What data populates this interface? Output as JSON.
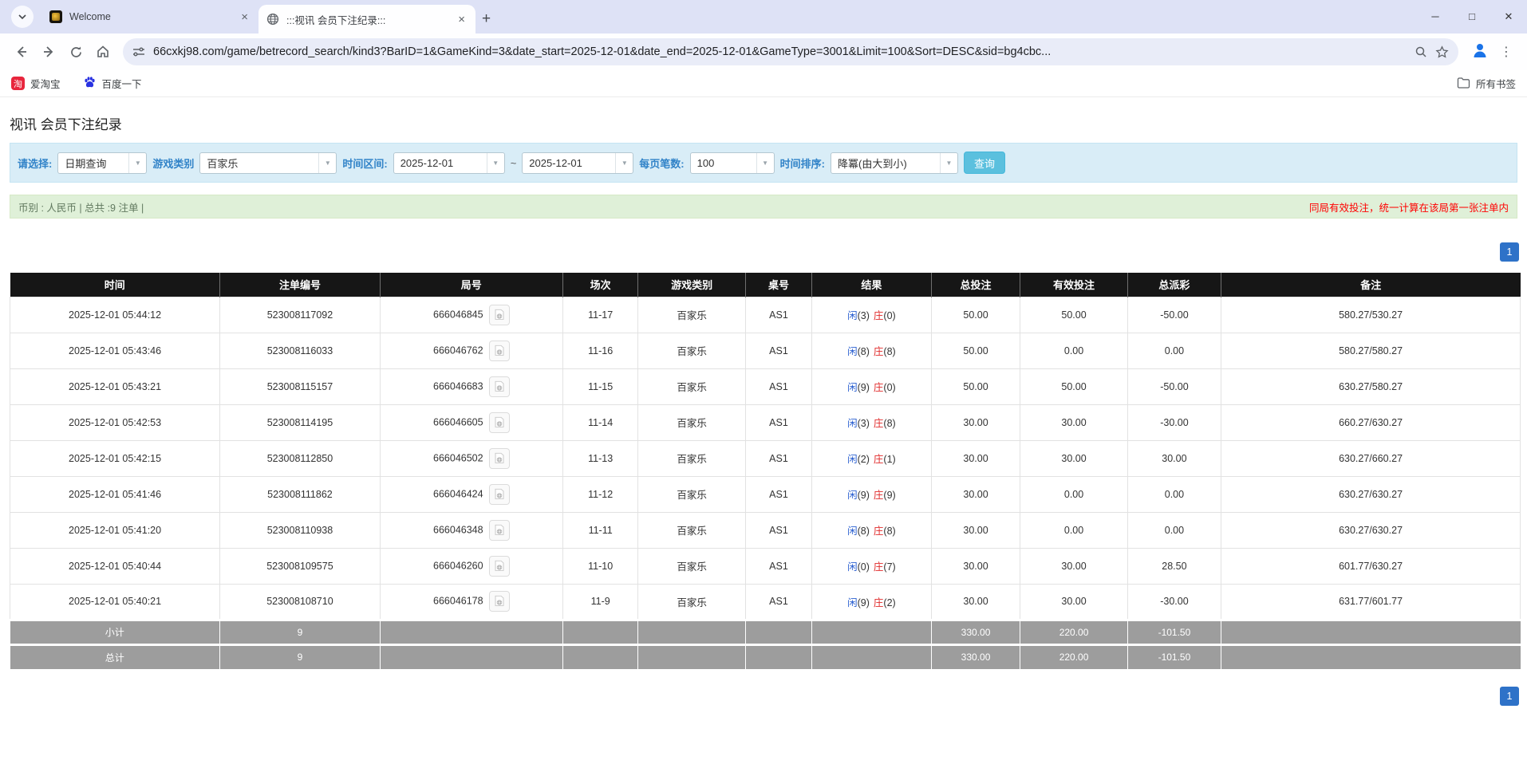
{
  "colors": {
    "header_bg": "#161616",
    "footer_bg": "#9d9d9d",
    "link_blue": "#2470d8",
    "player_blue": "#2a5fd0",
    "banker_red": "#e02b2b",
    "negative_red": "#ff1515",
    "filter_bg": "#d9edf7",
    "filter_label": "#3183c8",
    "summary_bg": "#dff0d8",
    "button_bg": "#5bc0de",
    "pager_bg": "#2e72c8"
  },
  "browser": {
    "tabs": [
      {
        "title": "Welcome"
      },
      {
        "title": ":::视讯 会员下注纪录:::"
      }
    ],
    "url": "66cxkj98.com/game/betrecord_search/kind3?BarID=1&GameKind=3&date_start=2025-12-01&date_end=2025-12-01&GameType=3001&Limit=100&Sort=DESC&sid=bg4cbc...",
    "bookmarks": {
      "item1": "爱淘宝",
      "item2": "百度一下",
      "all_bookmarks": "所有书签"
    }
  },
  "page": {
    "title": "视讯 会员下注纪录",
    "filters": {
      "select_label": "请选择:",
      "select_value": "日期查询",
      "game_label": "游戏类别",
      "game_value": "百家乐",
      "range_label": "时间区间:",
      "date_start": "2025-12-01",
      "tilde": "~",
      "date_end": "2025-12-01",
      "per_page_label": "每页笔数:",
      "per_page_value": "100",
      "sort_label": "时间排序:",
      "sort_value": "降冪(由大到小)",
      "search_button": "查询"
    },
    "summary": {
      "left": "币别 : 人民币 | 总共 :9 注单 |",
      "right": "同局有效投注，统一计算在该局第一张注单内"
    },
    "pagination": "1",
    "table": {
      "headers": [
        "时间",
        "注单编号",
        "局号",
        "场次",
        "游戏类别",
        "桌号",
        "结果",
        "总投注",
        "有效投注",
        "总派彩",
        "备注"
      ],
      "rows": [
        {
          "time": "2025-12-01 05:44:12",
          "bet_id": "523008117092",
          "round_id": "666046845",
          "session": "11-17",
          "game": "百家乐",
          "table_no": "AS1",
          "p_label": "闲",
          "p_val": "(3)",
          "b_label": "庄",
          "b_val": "(0)",
          "total_bet": "50.00",
          "valid_bet": "50.00",
          "payout": "-50.00",
          "remark": "580.27/530.27"
        },
        {
          "time": "2025-12-01 05:43:46",
          "bet_id": "523008116033",
          "round_id": "666046762",
          "session": "11-16",
          "game": "百家乐",
          "table_no": "AS1",
          "p_label": "闲",
          "p_val": "(8)",
          "b_label": "庄",
          "b_val": "(8)",
          "total_bet": "50.00",
          "valid_bet": "0.00",
          "payout": "0.00",
          "remark": "580.27/580.27"
        },
        {
          "time": "2025-12-01 05:43:21",
          "bet_id": "523008115157",
          "round_id": "666046683",
          "session": "11-15",
          "game": "百家乐",
          "table_no": "AS1",
          "p_label": "闲",
          "p_val": "(9)",
          "b_label": "庄",
          "b_val": "(0)",
          "total_bet": "50.00",
          "valid_bet": "50.00",
          "payout": "-50.00",
          "remark": "630.27/580.27"
        },
        {
          "time": "2025-12-01 05:42:53",
          "bet_id": "523008114195",
          "round_id": "666046605",
          "session": "11-14",
          "game": "百家乐",
          "table_no": "AS1",
          "p_label": "闲",
          "p_val": "(3)",
          "b_label": "庄",
          "b_val": "(8)",
          "total_bet": "30.00",
          "valid_bet": "30.00",
          "payout": "-30.00",
          "remark": "660.27/630.27"
        },
        {
          "time": "2025-12-01 05:42:15",
          "bet_id": "523008112850",
          "round_id": "666046502",
          "session": "11-13",
          "game": "百家乐",
          "table_no": "AS1",
          "p_label": "闲",
          "p_val": "(2)",
          "b_label": "庄",
          "b_val": "(1)",
          "total_bet": "30.00",
          "valid_bet": "30.00",
          "payout": "30.00",
          "remark": "630.27/660.27"
        },
        {
          "time": "2025-12-01 05:41:46",
          "bet_id": "523008111862",
          "round_id": "666046424",
          "session": "11-12",
          "game": "百家乐",
          "table_no": "AS1",
          "p_label": "闲",
          "p_val": "(9)",
          "b_label": "庄",
          "b_val": "(9)",
          "total_bet": "30.00",
          "valid_bet": "0.00",
          "payout": "0.00",
          "remark": "630.27/630.27"
        },
        {
          "time": "2025-12-01 05:41:20",
          "bet_id": "523008110938",
          "round_id": "666046348",
          "session": "11-11",
          "game": "百家乐",
          "table_no": "AS1",
          "p_label": "闲",
          "p_val": "(8)",
          "b_label": "庄",
          "b_val": "(8)",
          "total_bet": "30.00",
          "valid_bet": "0.00",
          "payout": "0.00",
          "remark": "630.27/630.27"
        },
        {
          "time": "2025-12-01 05:40:44",
          "bet_id": "523008109575",
          "round_id": "666046260",
          "session": "11-10",
          "game": "百家乐",
          "table_no": "AS1",
          "p_label": "闲",
          "p_val": "(0)",
          "b_label": "庄",
          "b_val": "(7)",
          "total_bet": "30.00",
          "valid_bet": "30.00",
          "payout": "28.50",
          "remark": "601.77/630.27"
        },
        {
          "time": "2025-12-01 05:40:21",
          "bet_id": "523008108710",
          "round_id": "666046178",
          "session": "11-9",
          "game": "百家乐",
          "table_no": "AS1",
          "p_label": "闲",
          "p_val": "(9)",
          "b_label": "庄",
          "b_val": "(2)",
          "total_bet": "30.00",
          "valid_bet": "30.00",
          "payout": "-30.00",
          "remark": "631.77/601.77"
        }
      ],
      "subtotal": {
        "label": "小计",
        "count": "9",
        "total_bet": "330.00",
        "valid_bet": "220.00",
        "payout": "-101.50"
      },
      "total": {
        "label": "总计",
        "count": "9",
        "total_bet": "330.00",
        "valid_bet": "220.00",
        "payout": "-101.50"
      }
    }
  }
}
